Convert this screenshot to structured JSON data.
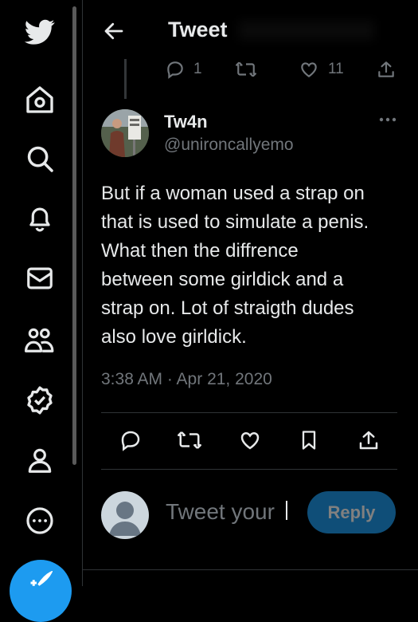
{
  "header": {
    "title": "Tweet"
  },
  "previous_tweet": {
    "reply_count": "1",
    "like_count": "11"
  },
  "tweet": {
    "author_name": "Tw4n",
    "author_handle": "@unironcallyemo",
    "text": "But if a woman used a strap on\nthat is used to simulate a penis.\nWhat then the diffrence\nbetween some girldick and a\nstrap on. Lot of straigth dudes\nalso love girldick.",
    "timestamp": "3:38 AM · Apr 21, 2020"
  },
  "reply_box": {
    "placeholder": "Tweet your",
    "button_label": "Reply"
  },
  "nav": {
    "items": [
      "twitter-logo",
      "home-icon",
      "search-icon",
      "bell-icon",
      "mail-icon",
      "communities-icon",
      "verified-icon",
      "profile-icon",
      "more-icon",
      "compose-icon"
    ]
  },
  "colors": {
    "accent": "#1d9bf0",
    "background": "#000000",
    "secondary_text": "#71767b"
  }
}
